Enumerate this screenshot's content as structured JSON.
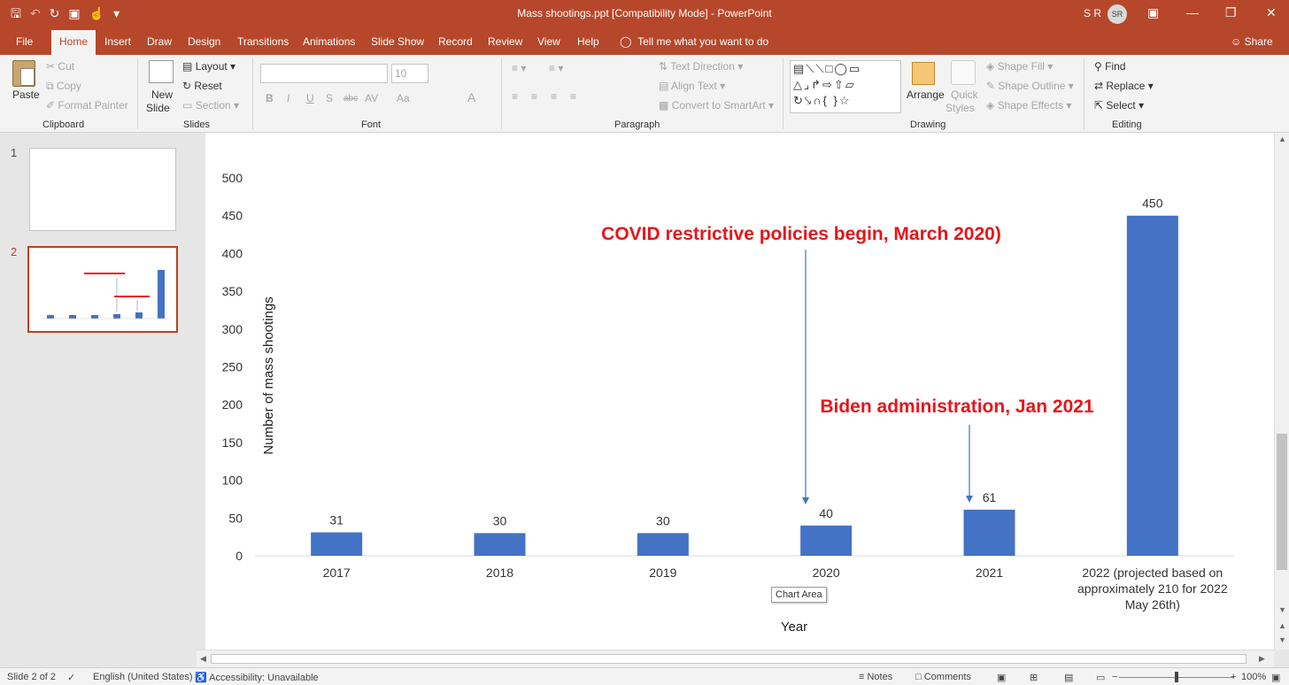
{
  "window": {
    "title": "Mass shootings.ppt [Compatibility Mode]  -  PowerPoint",
    "user_name": "S R",
    "user_initials": "SR"
  },
  "tabs": [
    "File",
    "Home",
    "Insert",
    "Draw",
    "Design",
    "Transitions",
    "Animations",
    "Slide Show",
    "Record",
    "Review",
    "View",
    "Help"
  ],
  "active_tab": "Home",
  "tell_me": "Tell me what you want to do",
  "share_label": "Share",
  "ribbon": {
    "clipboard": {
      "paste": "Paste",
      "cut": "Cut",
      "copy": "Copy",
      "format_painter": "Format Painter",
      "label": "Clipboard"
    },
    "slides": {
      "new_slide_1": "New",
      "new_slide_2": "Slide",
      "layout": "Layout",
      "reset": "Reset",
      "section": "Section",
      "label": "Slides"
    },
    "font": {
      "size": "10",
      "label": "Font",
      "buttons": [
        "B",
        "I",
        "U",
        "S",
        "abc",
        "AV",
        "Aa",
        "A"
      ]
    },
    "paragraph": {
      "text_direction": "Text Direction",
      "align_text": "Align Text",
      "convert_smartart": "Convert to SmartArt",
      "label": "Paragraph"
    },
    "drawing": {
      "arrange": "Arrange",
      "quick_styles_1": "Quick",
      "quick_styles_2": "Styles",
      "shape_fill": "Shape Fill",
      "shape_outline": "Shape Outline",
      "shape_effects": "Shape Effects",
      "label": "Drawing"
    },
    "editing": {
      "find": "Find",
      "replace": "Replace",
      "select": "Select",
      "label": "Editing"
    }
  },
  "thumbnails": [
    {
      "number": "1"
    },
    {
      "number": "2"
    }
  ],
  "chart_data": {
    "type": "bar",
    "categories": [
      "2017",
      "2018",
      "2019",
      "2020",
      "2021",
      "2022 (projected based on approximately 210 for 2022 May 26th)"
    ],
    "category_lines": [
      [
        "2017"
      ],
      [
        "2018"
      ],
      [
        "2019"
      ],
      [
        "2020"
      ],
      [
        "2021"
      ],
      [
        "2022 (projected based on",
        "approximately 210 for 2022",
        "May 26th)"
      ]
    ],
    "values": [
      31,
      30,
      30,
      40,
      61,
      450
    ],
    "xlabel": "Year",
    "ylabel": "Number of mass shootings",
    "ylim": [
      0,
      500
    ],
    "yticks": [
      0,
      50,
      100,
      150,
      200,
      250,
      300,
      350,
      400,
      450,
      500
    ],
    "bar_color": "#4472c4",
    "grid": false,
    "annotations": [
      {
        "text": "COVID restrictive policies begin, March 2020)",
        "color": "#e8151b",
        "points_to": "2020"
      },
      {
        "text": "Biden administration, Jan 2021",
        "color": "#e8151b",
        "points_to": "2021"
      }
    ]
  },
  "tooltip": "Chart Area",
  "status": {
    "slide": "Slide 2 of 2",
    "language": "English (United States)",
    "accessibility": "Accessibility: Unavailable",
    "notes": "Notes",
    "comments": "Comments",
    "zoom": "100%"
  },
  "colors": {
    "accent": "#b7472a",
    "selected": "#c43e1c"
  }
}
